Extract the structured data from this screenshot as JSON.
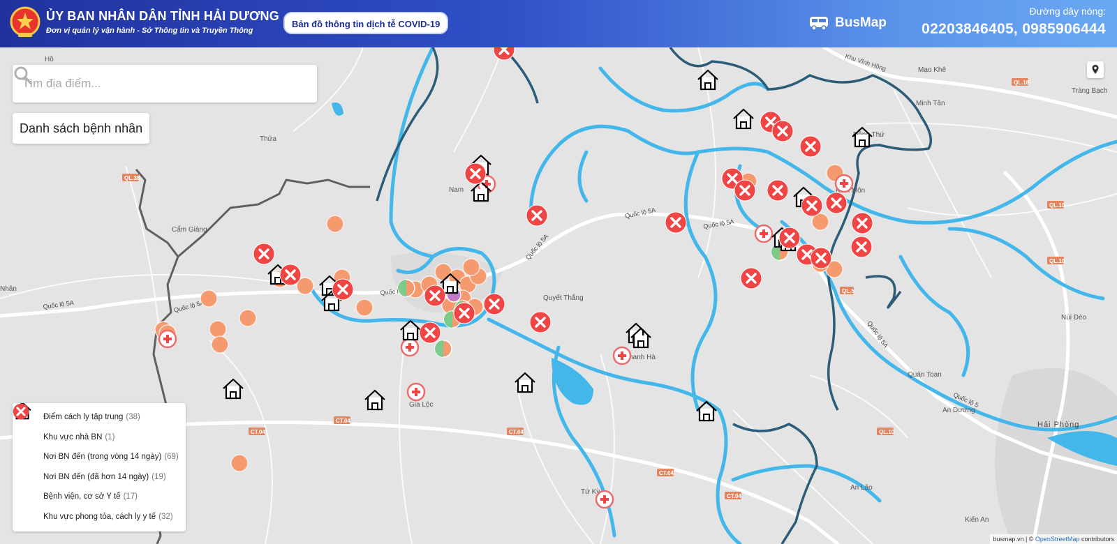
{
  "header": {
    "gov_title": "ỦY BAN NHÂN DÂN TỈNH HẢI DƯƠNG",
    "gov_subtitle": "Đơn vị quản lý vận hành - Sở Thông tin và Truyền Thông",
    "map_title": "Bản đồ thông tin dịch tễ COVID-19",
    "brand": "BusMap",
    "hotline_label": "Đường dây nóng:",
    "hotline_numbers": "02203846405, 0985906444"
  },
  "search": {
    "placeholder": "Tìm địa điểm..."
  },
  "patient_list_label": "Danh sách bệnh nhân",
  "legend": [
    {
      "icon": "house-icon",
      "label": "Điểm cách ly tập trung",
      "count": "(38)"
    },
    {
      "icon": "yellow-circle-icon",
      "label": "Khu vực nhà BN",
      "count": "(1)"
    },
    {
      "icon": "orange-circle-icon",
      "label": "Nơi BN đến (trong vòng 14 ngày)",
      "count": "(69)"
    },
    {
      "icon": "green-orange-circle-icon",
      "label": "Nơi BN đến (đã hơn 14 ngày)",
      "count": "(19)"
    },
    {
      "icon": "hospital-cross-icon",
      "label": "Bệnh viện, cơ sở Y tế",
      "count": "(17)"
    },
    {
      "icon": "red-x-icon",
      "label": "Khu vực phong tỏa, cách ly y tế",
      "count": "(32)"
    }
  ],
  "map_labels": [
    "Hồ",
    "Thứa",
    "Cẩm Giàng",
    "Nhân",
    "Quốc lộ 5A",
    "Nam",
    "Quyết Thắng",
    "Gia Lộc",
    "Thanh Hà",
    "Tứ Kỳ",
    "Mạo Khê",
    "Minh Tân",
    "Tràng Bạch",
    "Đông Thứ",
    "Kinh Môn",
    "Khu Vĩnh Hồng",
    "Núi Đèo",
    "Quán Toan",
    "An Dương",
    "Hải Phòng",
    "An Lão",
    "Kiến An",
    "QL.38",
    "QL.18",
    "QL.10",
    "QL.5",
    "CT.04",
    "Quốc lộ 5"
  ],
  "attribution": {
    "prefix": "busmap.vn | © ",
    "osm": "OpenStreetMap",
    "suffix": " contributors"
  },
  "colors": {
    "header_start": "#21329f",
    "header_end": "#6aa8f2",
    "river": "#43b6ea",
    "boundary": "#606060",
    "marker_orange": "#f59a6e",
    "marker_red": "#ef4545",
    "marker_green": "#7ccb8b"
  }
}
